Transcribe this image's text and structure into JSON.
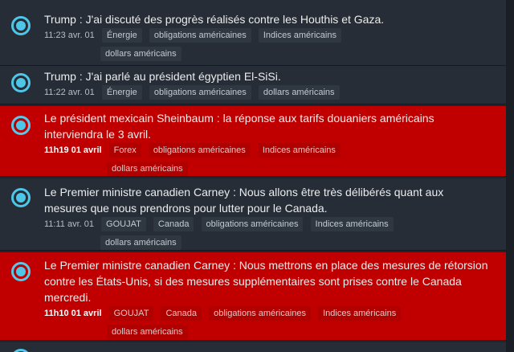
{
  "feed": {
    "items": [
      {
        "headline": "Trump : J'ai discuté des progrès réalisés contre les Houthis et Gaza.",
        "time": "11:23 avr. 01",
        "tags": [
          "Énergie",
          "obligations américaines",
          "Indices américains"
        ],
        "tags2": [
          "dollars américains"
        ],
        "highlight": false
      },
      {
        "headline": "Trump : J'ai parlé au président égyptien El-SiSi.",
        "time": "11:22 avr. 01",
        "tags": [
          "Énergie",
          "obligations américaines",
          "dollars américains"
        ],
        "tags2": [],
        "highlight": false
      },
      {
        "headline_line1": "Le président mexicain Sheinbaum : la réponse aux tarifs douaniers américains",
        "headline_line2": "interviendra le 3 avril.",
        "time": "11h19 01 avril",
        "tags": [
          "Forex",
          "obligations américaines",
          "Indices américains"
        ],
        "tags2": [
          "dollars américains"
        ],
        "highlight": true
      },
      {
        "headline_line1": "Le Premier ministre canadien Carney : Nous allons être très délibérés quant aux",
        "headline_line2": "mesures que nous prendrons pour lutter pour le Canada.",
        "time": "11:11 avr. 01",
        "tags": [
          "GOUJAT",
          "Canada",
          "obligations américaines",
          "Indices américains"
        ],
        "tags2": [
          "dollars américains"
        ],
        "highlight": false
      },
      {
        "headline_line1": "Le Premier ministre canadien Carney : Nous mettrons en place des mesures de rétorsion",
        "headline_line2": "contre les États-Unis, si des mesures supplémentaires sont prises contre le Canada",
        "headline_line3": "mercredi.",
        "time": "11h10 01 avril",
        "tags": [
          "GOUJAT",
          "Canada",
          "obligations américaines",
          "Indices américains"
        ],
        "tags2": [
          "dollars américains"
        ],
        "highlight": true
      }
    ]
  }
}
